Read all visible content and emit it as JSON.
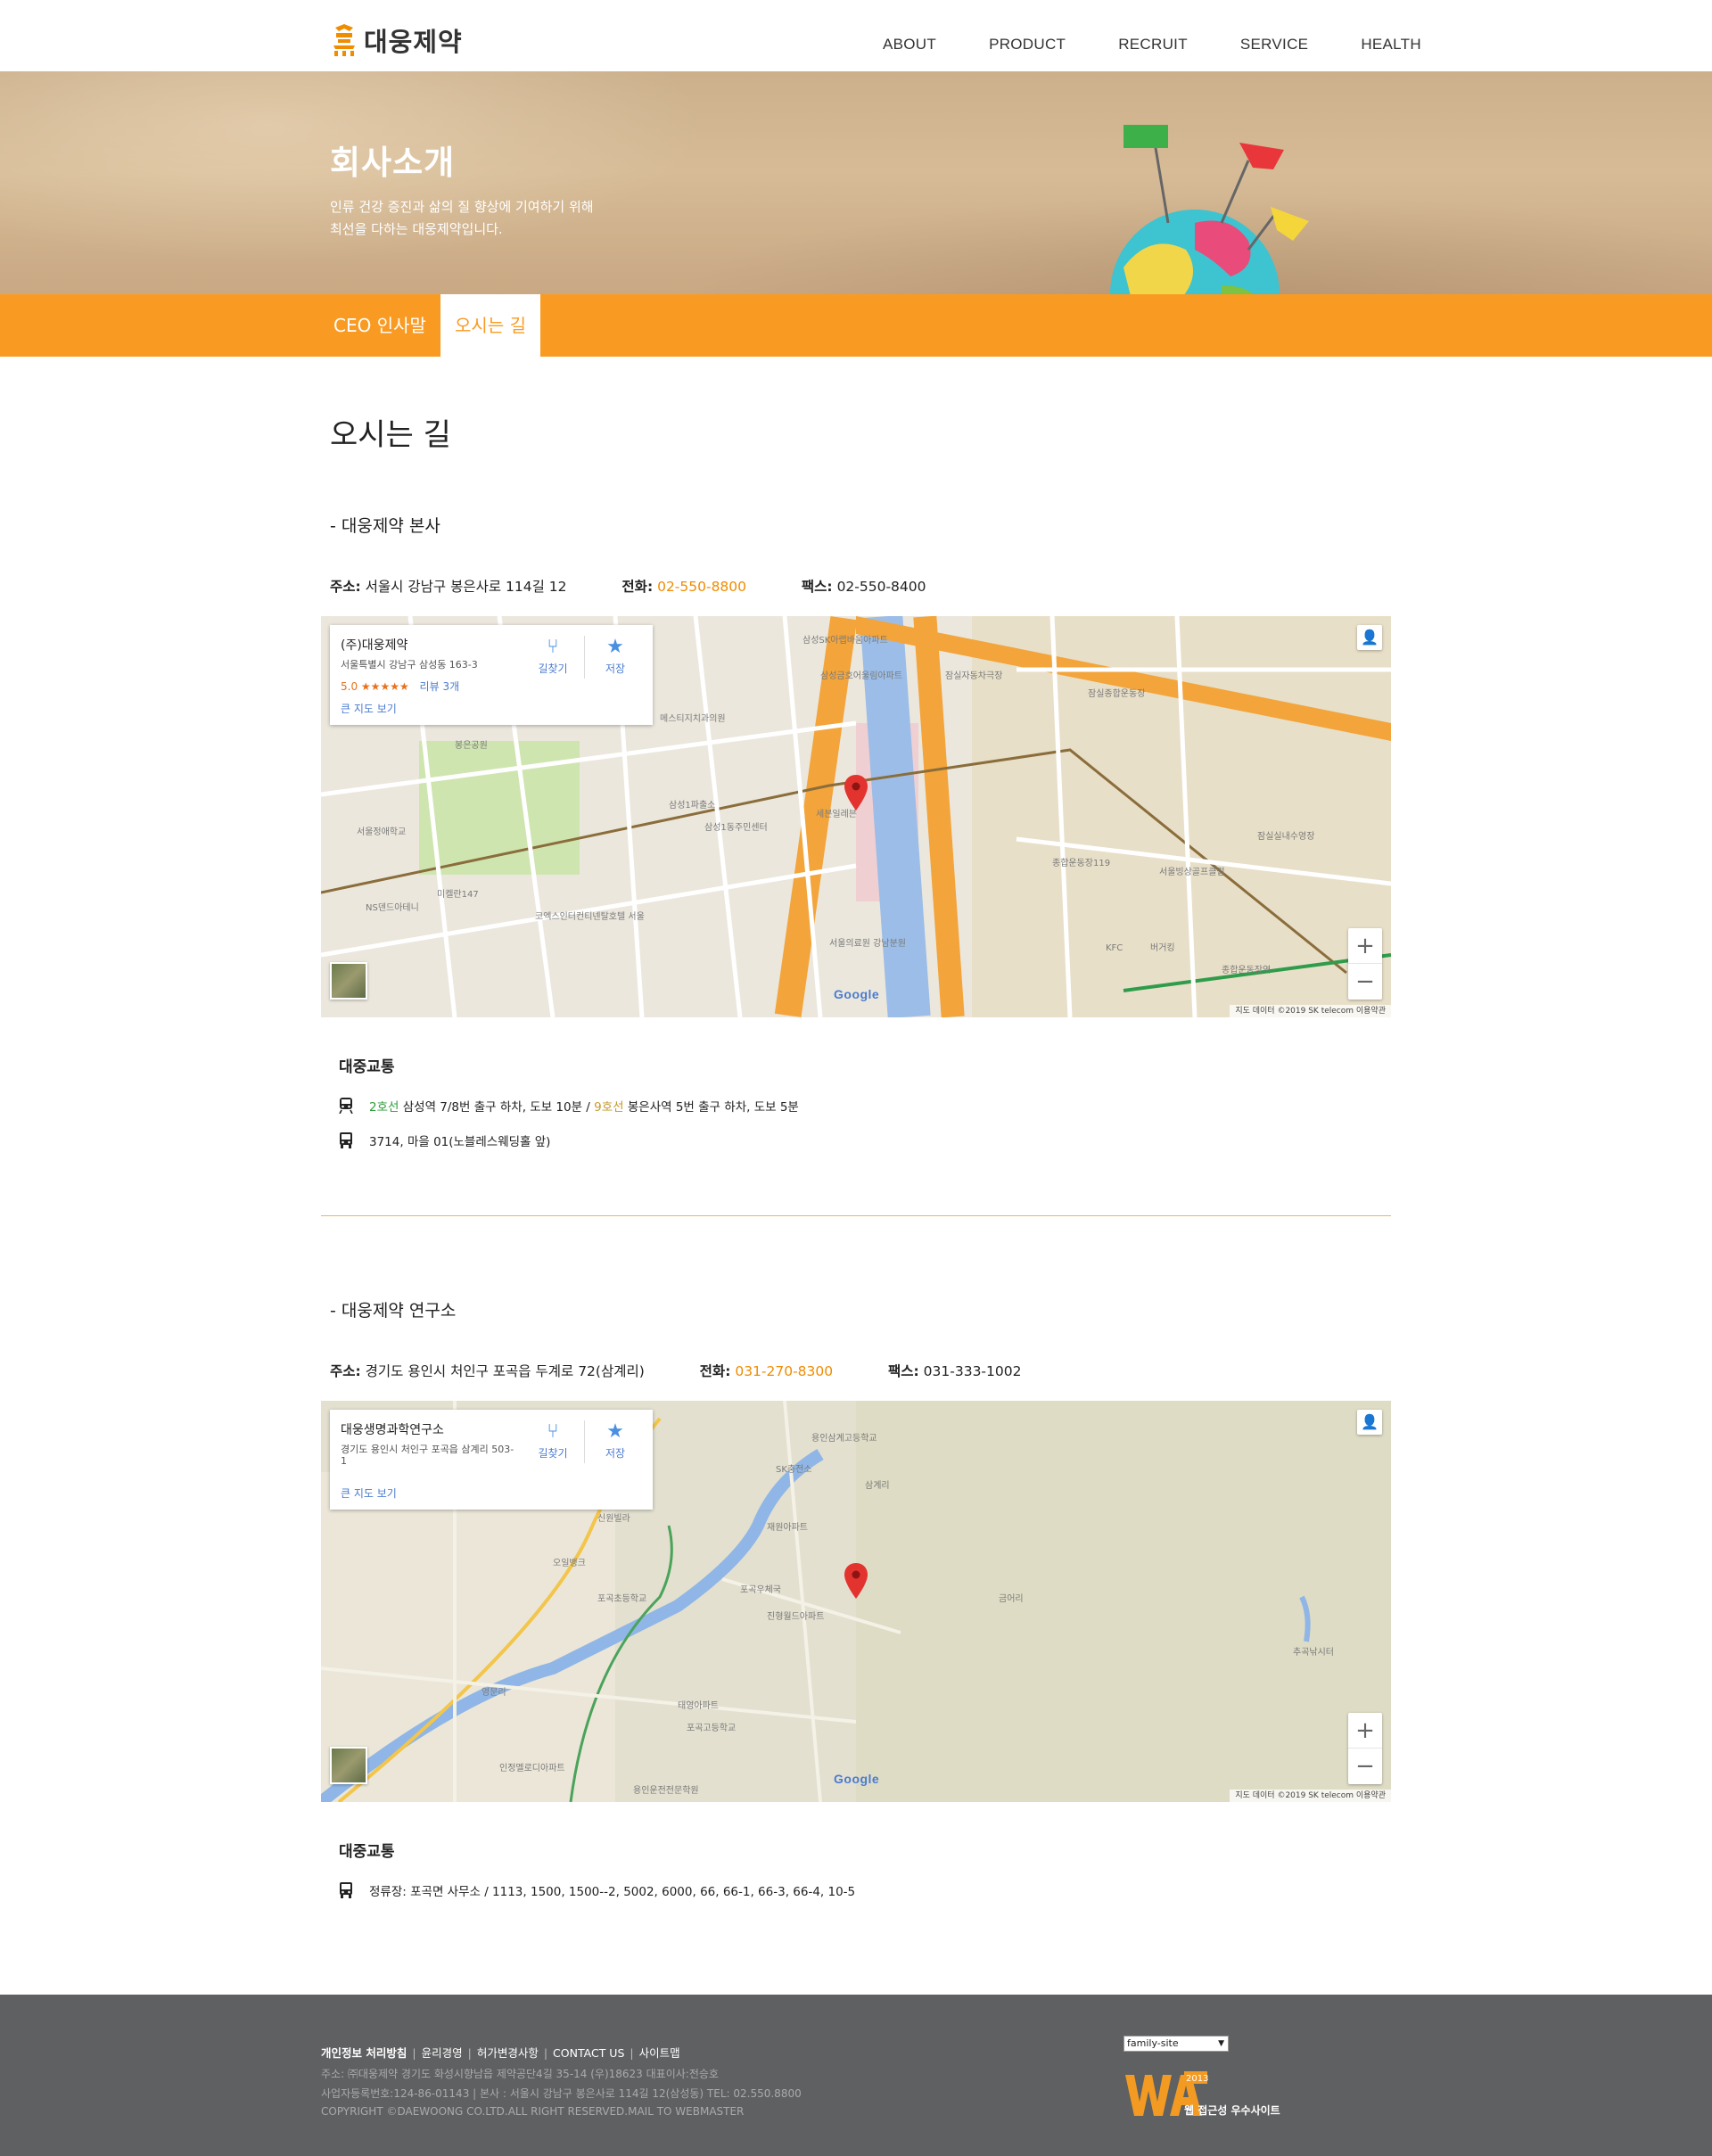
{
  "header": {
    "logo_text": "대웅제약",
    "nav": [
      "ABOUT",
      "PRODUCT",
      "RECRUIT",
      "SERVICE",
      "HEALTH"
    ]
  },
  "hero": {
    "title": "회사소개",
    "desc_line1": "인류 건강 증진과 삶의 질 향상에 기여하기 위해",
    "desc_line2": "최선을 다하는 대웅제약입니다."
  },
  "tabs": {
    "ceo": "CEO 인사말",
    "directions": "오시는 길"
  },
  "page_title": "오시는 길",
  "hq": {
    "title": "- 대웅제약 본사",
    "address_label": "주소:",
    "address": "서울시 강남구 봉은사로 114길 12",
    "phone_label": "전화:",
    "phone": "02-550-8800",
    "fax_label": "팩스:",
    "fax": "02-550-8400",
    "map": {
      "card_name": "(주)대웅제약",
      "card_address": "서울특별시 강남구 삼성동 163-3",
      "rating": "5.0",
      "stars": "★★★★★",
      "reviews": "리뷰 3개",
      "directions_btn": "길찾기",
      "save_btn": "저장",
      "larger_map": "큰 지도 보기",
      "attribution": "지도 데이터 ©2019 SK telecom    이용약관",
      "google": "Google"
    },
    "transit_title": "대중교통",
    "subway_line2": "2호선",
    "subway_text1": " 삼성역 7/8번 출구 하차, 도보 10분 / ",
    "subway_line9": "9호선",
    "subway_text2": " 봉은사역 5번 출구 하차, 도보 5분",
    "bus": "3714, 마을 01(노블레스웨딩홀 앞)"
  },
  "lab": {
    "title": "- 대웅제약 연구소",
    "address_label": "주소:",
    "address": "경기도 용인시 처인구 포곡읍 두계로 72(삼계리)",
    "phone_label": "전화:",
    "phone": "031-270-8300",
    "fax_label": "팩스:",
    "fax": "031-333-1002",
    "map": {
      "card_name": "대웅생명과학연구소",
      "card_address": "경기도 용인시 처인구 포곡읍 삼계리 503-1",
      "directions_btn": "길찾기",
      "save_btn": "저장",
      "larger_map": "큰 지도 보기",
      "attribution": "지도 데이터 ©2019 SK telecom    이용약관",
      "google": "Google"
    },
    "transit_title": "대중교통",
    "bus": "정류장: 포곡면 사무소 / 1113, 1500, 1500--2, 5002, 6000, 66, 66-1, 66-3, 66-4, 10-5"
  },
  "footer": {
    "links": [
      "개인정보 처리방침",
      "윤리경영",
      "허가변경사항",
      "CONTACT US",
      "사이트맵"
    ],
    "line1": "주소: ㈜대웅제약 경기도 화성시향남읍 제약공단4길 35-14 (우)18623 대표이사:전승호",
    "line2": "사업자등록번호:124-86-01143  |  본사 : 서울시 강남구 봉은사로 114길 12(삼성동) TEL: 02.550.8800",
    "line3": "COPYRIGHT ©DAEWOONG CO.LTD.ALL RIGHT RESERVED.MAIL TO WEBMASTER",
    "family_site": "family-site",
    "wa_year": "2013",
    "wa_text": "웹 접근성 우수사이트"
  },
  "colors": {
    "accent": "#f99b23",
    "footer_bg": "#5f6062",
    "phone": "#f08c00"
  }
}
